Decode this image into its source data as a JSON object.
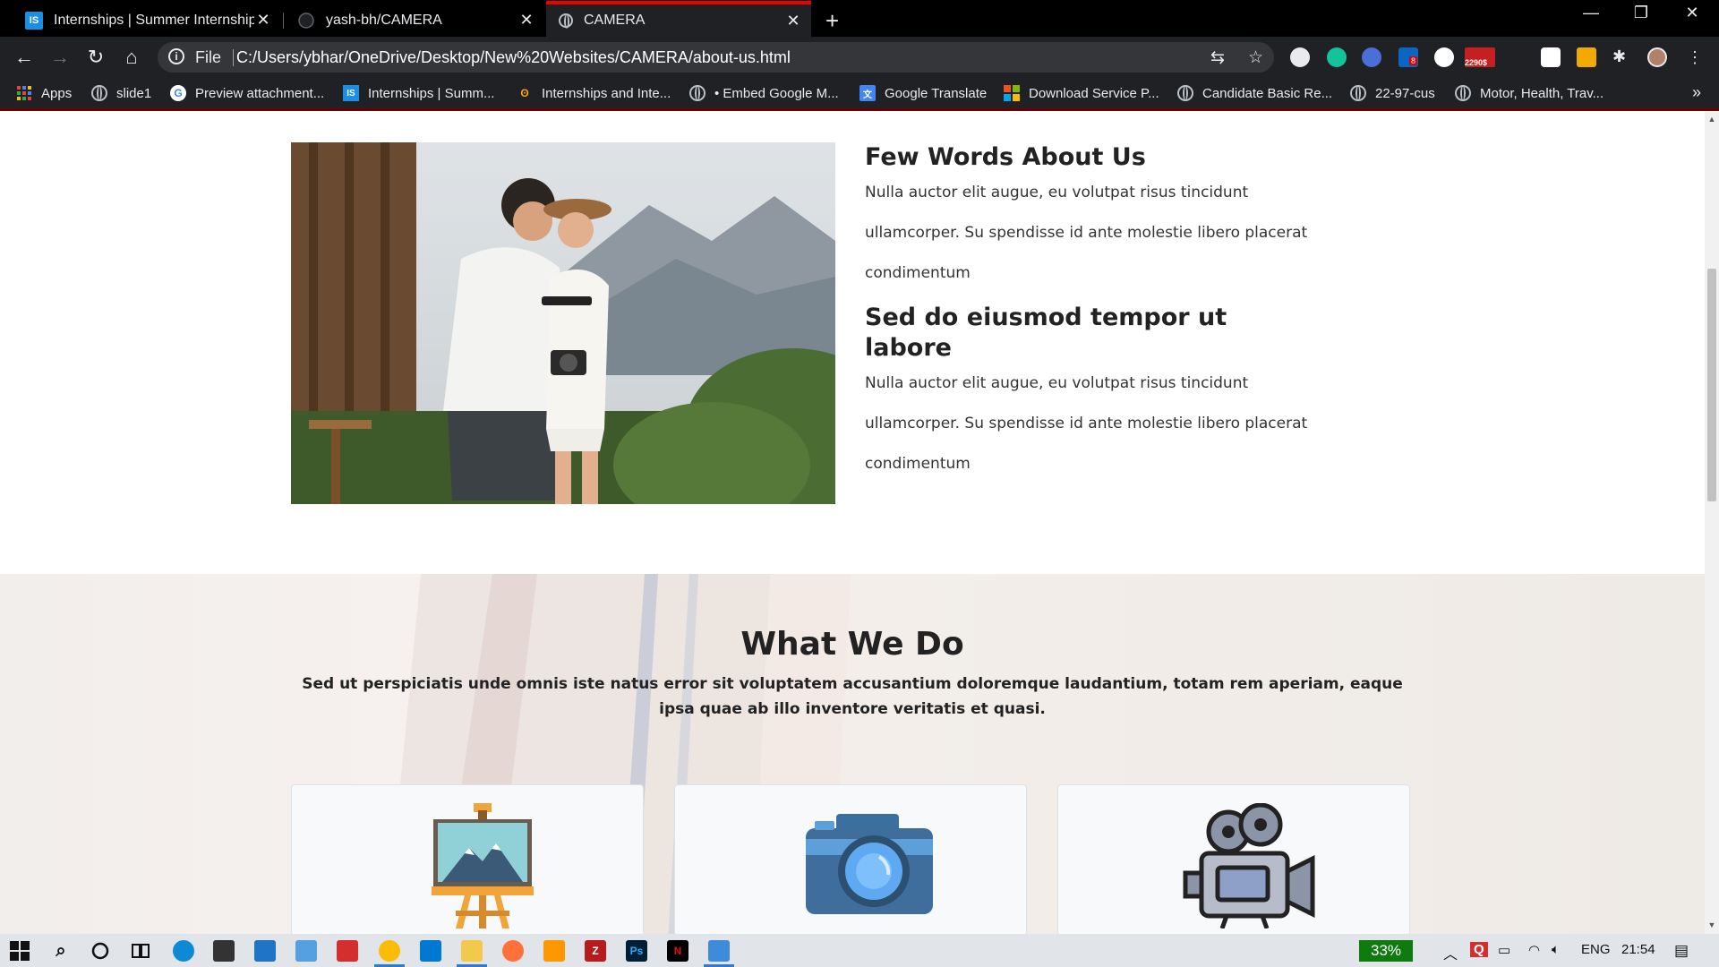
{
  "browser": {
    "tabs": [
      {
        "title": "Internships | Summer Internship",
        "favicon": "is-logo-icon",
        "active": false
      },
      {
        "title": "yash-bh/CAMERA",
        "favicon": "github-icon",
        "active": false
      },
      {
        "title": "CAMERA",
        "favicon": "globe-icon",
        "active": true
      }
    ],
    "omnibox": {
      "scheme": "File",
      "url": "C:/Users/ybhar/OneDrive/Desktop/New%20Websites/CAMERA/about-us.html"
    },
    "extensions": {
      "linkedin_badge": "8",
      "mail_badge": "2290$"
    },
    "bookmarks": [
      {
        "label": "Apps",
        "icon": "apps-grid-icon"
      },
      {
        "label": "slide1",
        "icon": "globe-icon"
      },
      {
        "label": "Preview attachment...",
        "icon": "google-icon"
      },
      {
        "label": "Internships | Summ...",
        "icon": "is-logo-icon"
      },
      {
        "label": "Internships and Inte...",
        "icon": "flame-icon"
      },
      {
        "label": "• Embed Google M...",
        "icon": "globe-icon"
      },
      {
        "label": "Google Translate",
        "icon": "translate-icon"
      },
      {
        "label": "Download Service P...",
        "icon": "microsoft-icon"
      },
      {
        "label": "Candidate Basic Re...",
        "icon": "globe-icon"
      },
      {
        "label": "22-97-cus",
        "icon": "globe-icon"
      },
      {
        "label": "Motor, Health, Trav...",
        "icon": "globe-icon"
      }
    ],
    "bookmarks_overflow": "»"
  },
  "about": {
    "heading1": "Few Words About Us",
    "para1_lines": [
      "Nulla auctor elit augue, eu volutpat risus tincidunt",
      "ullamcorper. Su spendisse id ante molestie libero placerat",
      "condimentum"
    ],
    "heading2": "Sed do eiusmod tempor ut labore",
    "para2_lines": [
      "Nulla auctor elit augue, eu volutpat risus tincidunt",
      "ullamcorper. Su spendisse id ante molestie libero placerat",
      "condimentum"
    ]
  },
  "what_we_do": {
    "title": "What We Do",
    "description": "Sed ut perspiciatis unde omnis iste natus error sit voluptatem accusantium doloremque laudantium, totam rem aperiam, eaque ipsa quae ab illo inventore veritatis et quasi.",
    "cards": [
      {
        "icon": "easel-painting-icon"
      },
      {
        "icon": "camera-icon"
      },
      {
        "icon": "video-camera-icon"
      }
    ]
  },
  "taskbar": {
    "battery": "33%",
    "language": "ENG",
    "time": "21:54"
  },
  "colors": {
    "tab_active_accent": "#ee0000",
    "chrome_dark": "#202124",
    "battery_green": "#0f7b0f"
  }
}
